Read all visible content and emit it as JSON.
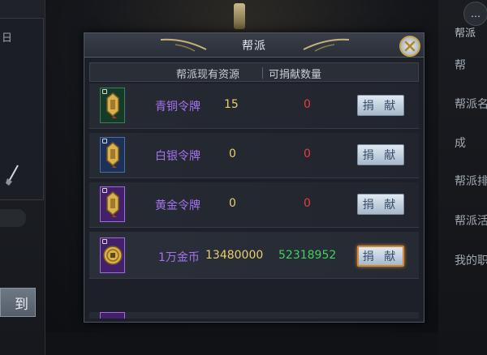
{
  "background": {
    "left_text": "日",
    "left_button_label": "到",
    "right_top_label": "帮派",
    "right_items": [
      "帮",
      "帮派名",
      "成",
      "帮派排",
      "帮派活",
      "我的职"
    ]
  },
  "dialog": {
    "title": "帮派",
    "columns": {
      "resources": "帮派现有资源",
      "donatable": "可捐献数量"
    },
    "rows": [
      {
        "name": "青铜令牌",
        "have": "15",
        "can": "0",
        "button": "捐 献",
        "rarity": "green",
        "can_color": "#e0403a"
      },
      {
        "name": "白银令牌",
        "have": "0",
        "can": "0",
        "button": "捐 献",
        "rarity": "blue",
        "can_color": "#e0403a"
      },
      {
        "name": "黄金令牌",
        "have": "0",
        "can": "0",
        "button": "捐 献",
        "rarity": "purple",
        "can_color": "#e0403a"
      },
      {
        "name": "1万金币",
        "have": "13480000",
        "can": "52318952",
        "button": "捐 献",
        "rarity": "purple",
        "can_color": "#3fd25e"
      }
    ]
  },
  "icons": {
    "close": "close-icon",
    "token": "token-icon",
    "coin": "gold-coin-icon",
    "lock": "lock-icon"
  },
  "colors": {
    "name_purple": "#a673f0",
    "have_gold": "#e8cf6a",
    "can_red": "#e0403a",
    "can_green": "#3fd25e",
    "selected_border": "#d08a3a"
  }
}
